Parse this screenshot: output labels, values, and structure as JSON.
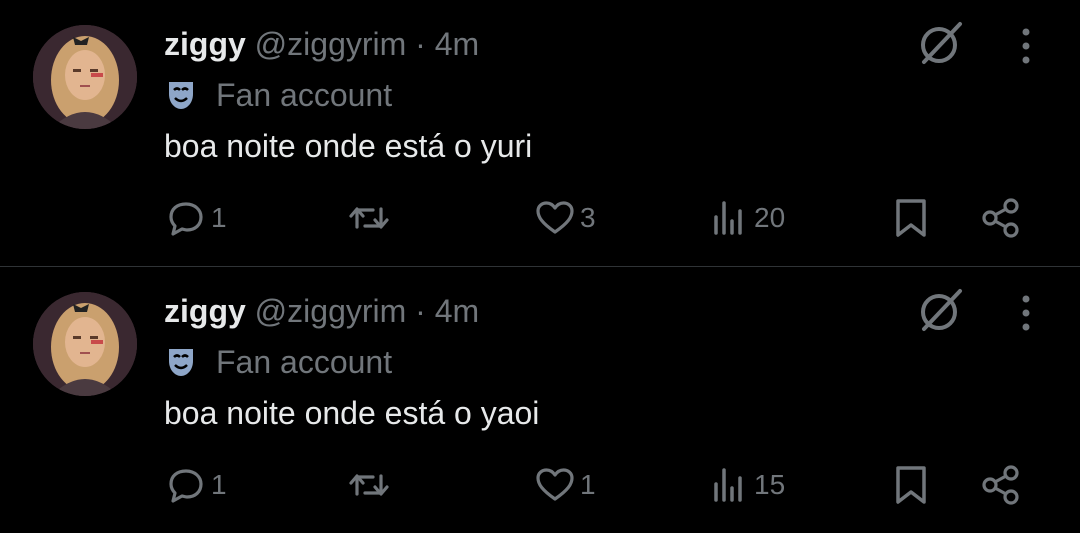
{
  "colors": {
    "background": "#000000",
    "primary_text": "#e7e9ea",
    "secondary_text": "#71767b",
    "divider": "#2f3336",
    "mask_badge": "#8ea6c8"
  },
  "tweets": [
    {
      "name": "ziggy",
      "handle": "@ziggyrim",
      "separator": "·",
      "time": "4m",
      "badge_label": "Fan account",
      "text": "boa noite onde está o yuri",
      "replies": "1",
      "retweets": "",
      "likes": "3",
      "views": "20"
    },
    {
      "name": "ziggy",
      "handle": "@ziggyrim",
      "separator": "·",
      "time": "4m",
      "badge_label": "Fan account",
      "text": "boa noite onde está o yaoi",
      "replies": "1",
      "retweets": "",
      "likes": "1",
      "views": "15"
    }
  ],
  "icons": {
    "avatar": "avatar-photo",
    "badge": "theater-mask-icon",
    "grok": "grok-slash-circle-icon",
    "more": "vertical-dots-icon",
    "reply": "speech-bubble-icon",
    "retweet": "retweet-arrows-icon",
    "like": "heart-icon",
    "views": "bar-chart-icon",
    "bookmark": "bookmark-icon",
    "share": "share-nodes-icon"
  }
}
